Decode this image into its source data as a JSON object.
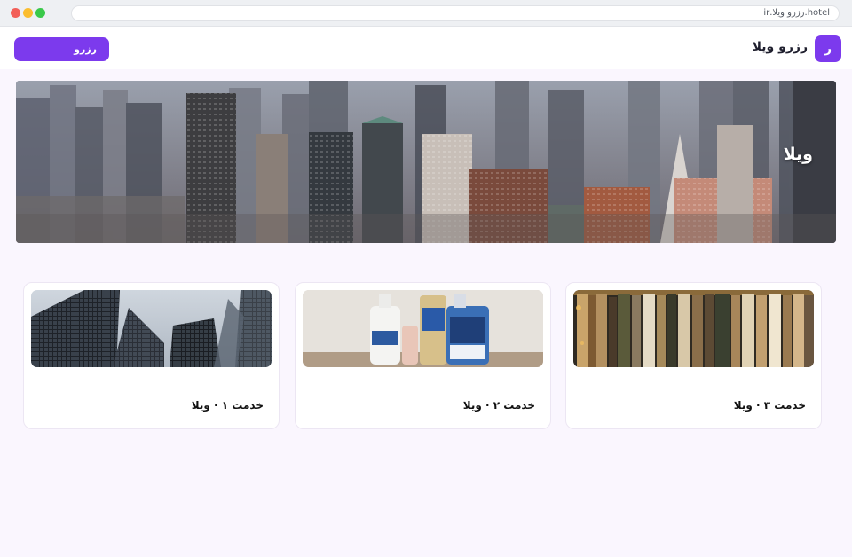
{
  "browser": {
    "url": "hotel.رزرو ویلا.ir"
  },
  "header": {
    "logo_letter": "ر",
    "brand": "رزرو ویلا",
    "book_button": "رزرو"
  },
  "hero": {
    "title": "ویلا"
  },
  "cards": [
    {
      "title": "خدمت ۳ · ویلا",
      "image": "clothing-rack-photo"
    },
    {
      "title": "خدمت ۲ · ویلا",
      "image": "cleaning-products-photo"
    },
    {
      "title": "خدمت ۱ · ویلا",
      "image": "glass-towers-photo"
    }
  ],
  "colors": {
    "accent": "#7c3aed",
    "page_background": "#faf6fe",
    "card_background": "#ffffff"
  }
}
